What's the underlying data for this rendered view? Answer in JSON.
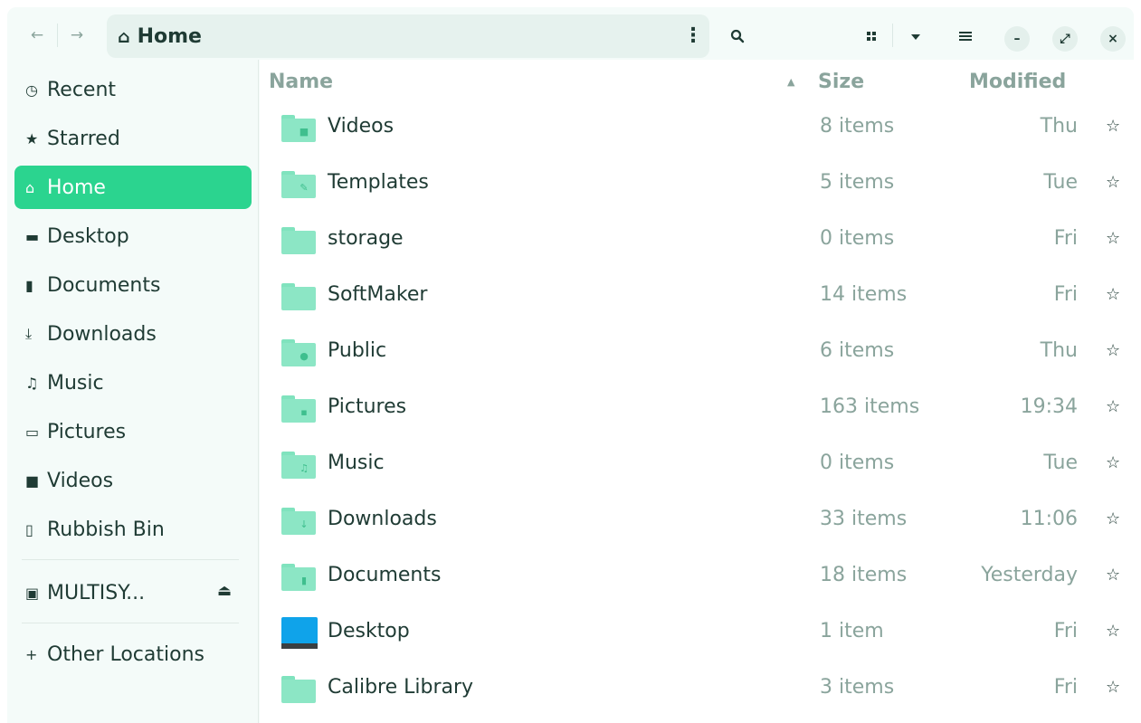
{
  "headerbar": {
    "back": "←",
    "forward": "→",
    "path_icon": "⌂",
    "path_label": "Home",
    "path_menu": "⋮",
    "search_icon": "search-icon",
    "view_grid_icon": "grid-icon",
    "view_dropdown_icon": "chevron-down-icon",
    "menu_icon": "hamburger-icon",
    "minimize": "–",
    "maximize": "⤢",
    "close": "×"
  },
  "sidebar": {
    "items": [
      {
        "icon": "◷",
        "label": "Recent"
      },
      {
        "icon": "★",
        "label": "Starred"
      },
      {
        "icon": "⌂",
        "label": "Home"
      },
      {
        "icon": "▬",
        "label": "Desktop"
      },
      {
        "icon": "▮",
        "label": "Documents"
      },
      {
        "icon": "⤓",
        "label": "Downloads"
      },
      {
        "icon": "♫",
        "label": "Music"
      },
      {
        "icon": "▭",
        "label": "Pictures"
      },
      {
        "icon": "■",
        "label": "Videos"
      },
      {
        "icon": "▯",
        "label": "Rubbish Bin"
      }
    ],
    "drive": {
      "icon": "▣",
      "label": "MULTISY...",
      "eject": "⏏"
    },
    "other_locations": {
      "icon": "+",
      "label": "Other Locations"
    }
  },
  "columns": {
    "name": "Name",
    "size": "Size",
    "modified": "Modified",
    "sort_indicator": "▲"
  },
  "files": [
    {
      "name": "Videos",
      "size": "8 items",
      "modified": "Thu",
      "emblem": "■"
    },
    {
      "name": "Templates",
      "size": "5 items",
      "modified": "Tue",
      "emblem": "✎"
    },
    {
      "name": "storage",
      "size": "0 items",
      "modified": "Fri",
      "emblem": ""
    },
    {
      "name": "SoftMaker",
      "size": "14 items",
      "modified": "Fri",
      "emblem": ""
    },
    {
      "name": "Public",
      "size": "6 items",
      "modified": "Thu",
      "emblem": "●"
    },
    {
      "name": "Pictures",
      "size": "163 items",
      "modified": "19:34",
      "emblem": "▪"
    },
    {
      "name": "Music",
      "size": "0 items",
      "modified": "Tue",
      "emblem": "♫"
    },
    {
      "name": "Downloads",
      "size": "33 items",
      "modified": "11:06",
      "emblem": "↓"
    },
    {
      "name": "Documents",
      "size": "18 items",
      "modified": "Yesterday",
      "emblem": "▮"
    },
    {
      "name": "Desktop",
      "size": "1 item",
      "modified": "Fri",
      "emblem": "desktop"
    },
    {
      "name": "Calibre Library",
      "size": "3 items",
      "modified": "Fri",
      "emblem": ""
    }
  ],
  "star_glyph": "☆",
  "colors": {
    "accent": "#2bd48f",
    "folder": "#8ce6c5",
    "muted_text": "#8aa49c"
  }
}
